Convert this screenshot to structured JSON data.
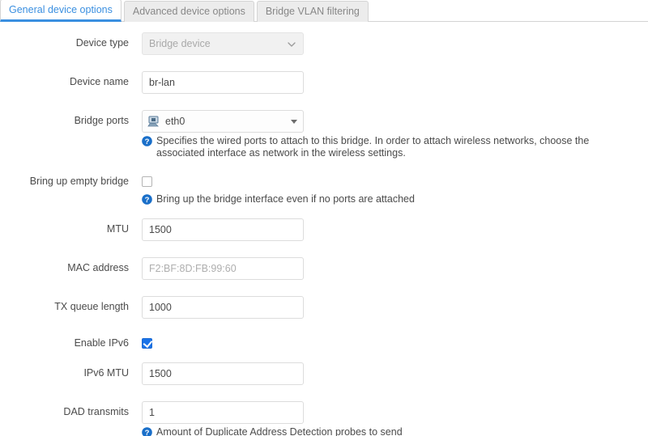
{
  "tabs": [
    {
      "label": "General device options",
      "active": true
    },
    {
      "label": "Advanced device options",
      "active": false
    },
    {
      "label": "Bridge VLAN filtering",
      "active": false
    }
  ],
  "colors": {
    "accent_blue": "#3a8fe0",
    "help_icon_blue": "#1a6fc9",
    "checkbox_blue": "#1a73e8",
    "label_text": "#4b4b4b",
    "placeholder_text": "#aeaeae",
    "disabled_bg": "#f1f1f1",
    "inactive_tab_bg": "#ececec",
    "border": "#dcdcdc"
  },
  "fields": {
    "device_type": {
      "label": "Device type",
      "value": "Bridge device",
      "disabled": true,
      "icon": "chevron-down-icon"
    },
    "device_name": {
      "label": "Device name",
      "value": "br-lan",
      "placeholder": ""
    },
    "bridge_ports": {
      "label": "Bridge ports",
      "value": "eth0",
      "item_icon": "ethernet-nic-icon",
      "caret_icon": "caret-down-icon",
      "help": "Specifies the wired ports to attach to this bridge. In order to attach wireless networks, choose the associated interface as network in the wireless settings."
    },
    "bring_up_empty_bridge": {
      "label": "Bring up empty bridge",
      "checked": false,
      "help": "Bring up the bridge interface even if no ports are attached"
    },
    "mtu": {
      "label": "MTU",
      "value": "1500",
      "placeholder": ""
    },
    "mac_address": {
      "label": "MAC address",
      "value": "",
      "placeholder": "F2:BF:8D:FB:99:60"
    },
    "tx_queue_length": {
      "label": "TX queue length",
      "value": "1000",
      "placeholder": ""
    },
    "enable_ipv6": {
      "label": "Enable IPv6",
      "checked": true
    },
    "ipv6_mtu": {
      "label": "IPv6 MTU",
      "value": "1500",
      "placeholder": ""
    },
    "dad_transmits": {
      "label": "DAD transmits",
      "value": "1",
      "placeholder": "",
      "help": "Amount of Duplicate Address Detection probes to send"
    }
  },
  "icons": {
    "help": "question-circle-icon"
  }
}
